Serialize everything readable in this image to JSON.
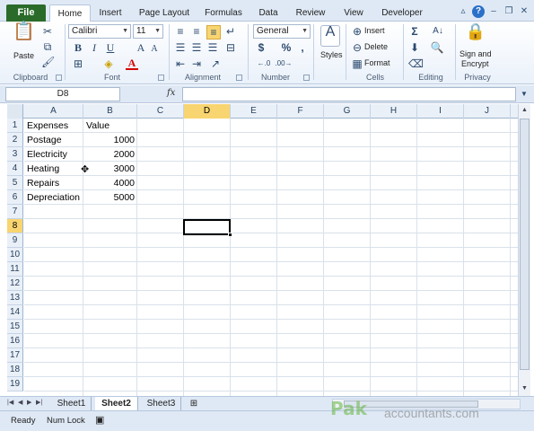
{
  "ribbon_tabs": {
    "file": "File",
    "home": "Home",
    "insert": "Insert",
    "page_layout": "Page Layout",
    "formulas": "Formulas",
    "data": "Data",
    "review": "Review",
    "view": "View",
    "developer": "Developer"
  },
  "clipboard": {
    "paste": "Paste",
    "label": "Clipboard"
  },
  "font": {
    "name": "Calibri",
    "size": "11",
    "bold": "B",
    "italic": "I",
    "underline": "U",
    "grow": "A",
    "shrink": "A",
    "label": "Font"
  },
  "alignment": {
    "label": "Alignment"
  },
  "number": {
    "format": "General",
    "currency": "$",
    "percent": "%",
    "comma": ",",
    "label": "Number"
  },
  "styles": {
    "label": "Styles"
  },
  "cells": {
    "insert": "Insert",
    "delete": "Delete",
    "format": "Format",
    "label": "Cells"
  },
  "editing": {
    "label": "Editing"
  },
  "privacy": {
    "sign": "Sign and",
    "encrypt": "Encrypt",
    "label": "Privacy"
  },
  "formula_bar": {
    "name_box": "D8",
    "fx": "fx",
    "formula": ""
  },
  "grid": {
    "columns": [
      "A",
      "B",
      "C",
      "D",
      "E",
      "F",
      "G",
      "H",
      "I",
      "J"
    ],
    "selected_column": "D",
    "rows": [
      "1",
      "2",
      "3",
      "4",
      "5",
      "6",
      "7",
      "8",
      "9",
      "10",
      "11",
      "12",
      "13",
      "14",
      "15",
      "16",
      "17",
      "18",
      "19"
    ],
    "selected_row": "8",
    "cells": {
      "A1": "Expenses",
      "B1": "Value",
      "A2": "Postage",
      "B2": "1000",
      "A3": "Electricity",
      "B3": "2000",
      "A4": "Heating",
      "B4": "3000",
      "A5": "Repairs",
      "B5": "4000",
      "A6": "Depreciation",
      "B6": "5000"
    }
  },
  "sheet_tabs": [
    "Sheet1",
    "Sheet2",
    "Sheet3"
  ],
  "active_sheet": "Sheet2",
  "status": {
    "ready": "Ready",
    "num_lock": "Num Lock"
  },
  "watermark": {
    "brand": "Pak",
    "text": "accountants.com"
  },
  "colors": {
    "file_tab": "#2a6b2a",
    "selection": "#f8d570",
    "ribbon_bg": "#dfe9f5"
  },
  "icons": [
    "paste-icon",
    "cut-icon",
    "copy-icon",
    "format-painter-icon",
    "bold-icon",
    "italic-icon",
    "underline-icon",
    "border-icon",
    "fill-color-icon",
    "font-color-icon",
    "align-top-icon",
    "align-middle-icon",
    "align-bottom-icon",
    "wrap-text-icon",
    "align-left-icon",
    "align-center-icon",
    "align-right-icon",
    "merge-icon",
    "currency-icon",
    "percent-icon",
    "comma-icon",
    "increase-decimal-icon",
    "decrease-decimal-icon",
    "styles-icon",
    "insert-cells-icon",
    "delete-cells-icon",
    "format-cells-icon",
    "autosum-icon",
    "sort-filter-icon",
    "fill-icon",
    "clear-icon",
    "sign-encrypt-icon",
    "help-icon",
    "minimize-icon",
    "restore-icon",
    "close-icon"
  ]
}
